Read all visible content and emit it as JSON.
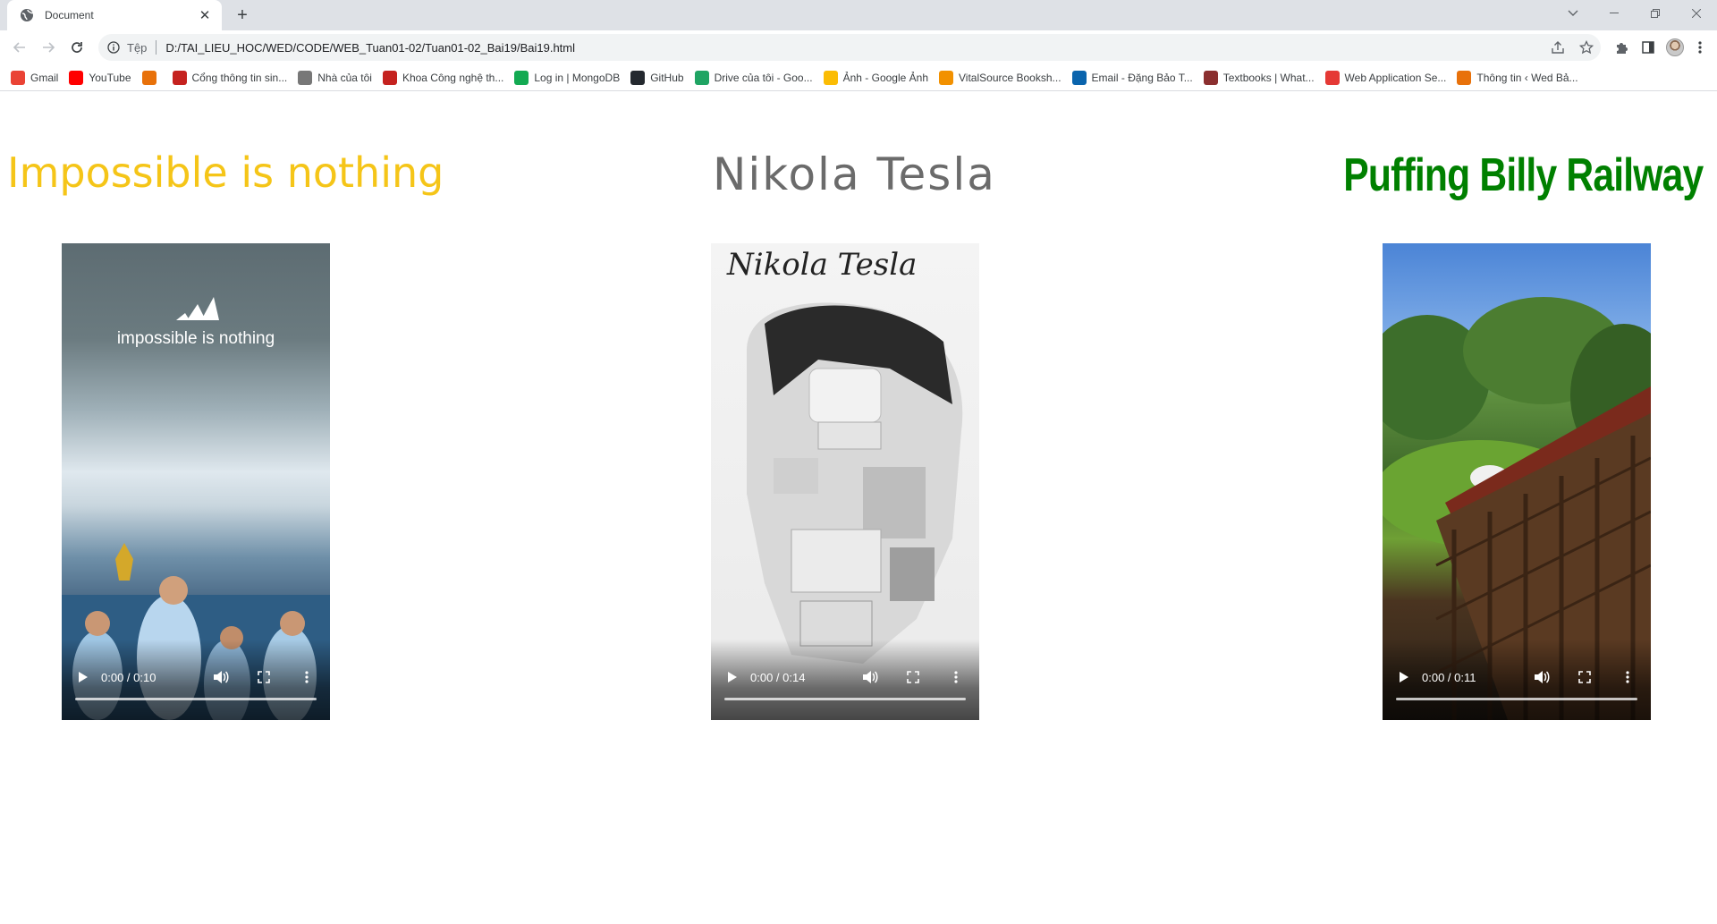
{
  "browser": {
    "tab_title": "Document",
    "address_scheme": "Tệp",
    "address_url": "D:/TAI_LIEU_HOC/WED/CODE/WEB_Tuan01-02/Tuan01-02_Bai19/Bai19.html"
  },
  "bookmarks": [
    {
      "label": "Gmail",
      "icon": "gmail-icon",
      "color": "#ea4335"
    },
    {
      "label": "YouTube",
      "icon": "youtube-icon",
      "color": "#ff0000"
    },
    {
      "label": "",
      "icon": "grid-app-icon",
      "color": "#e8710a"
    },
    {
      "label": "Cổng thông tin sin...",
      "icon": "university-icon",
      "color": "#c5221f"
    },
    {
      "label": "Nhà của tôi",
      "icon": "home-doc-icon",
      "color": "#777777"
    },
    {
      "label": "Khoa Công nghệ th...",
      "icon": "university-icon",
      "color": "#c5221f"
    },
    {
      "label": "Log in | MongoDB",
      "icon": "mongodb-icon",
      "color": "#13aa52"
    },
    {
      "label": "GitHub",
      "icon": "github-icon",
      "color": "#24292f"
    },
    {
      "label": "Drive của tôi - Goo...",
      "icon": "drive-icon",
      "color": "#1fa463"
    },
    {
      "label": "Ảnh - Google Ảnh",
      "icon": "photos-icon",
      "color": "#fbbc04"
    },
    {
      "label": "VitalSource Booksh...",
      "icon": "vitalsource-icon",
      "color": "#f29100"
    },
    {
      "label": "Email - Đặng Bảo T...",
      "icon": "outlook-icon",
      "color": "#0a64ad"
    },
    {
      "label": "Textbooks | What...",
      "icon": "shield-icon",
      "color": "#8b2f2f"
    },
    {
      "label": "Web Application Se...",
      "icon": "webapp-icon",
      "color": "#e53935"
    },
    {
      "label": "Thông tin ‹ Wed Bả...",
      "icon": "grid-app-icon",
      "color": "#e8710a"
    }
  ],
  "page": {
    "headings": {
      "left": "Impossible is nothing",
      "center": "Nikola Tesla",
      "right": "Puffing Billy Railway"
    },
    "videos": [
      {
        "time": "0:00 / 0:10",
        "progress": 0,
        "overlay_text": "impossible is nothing"
      },
      {
        "time": "0:00 / 0:14",
        "progress": 0,
        "overlay_text": "Nikola Tesla"
      },
      {
        "time": "0:00 / 0:11",
        "progress": 0,
        "overlay_text": ""
      }
    ]
  },
  "colors": {
    "left_heading": "#f5c518",
    "center_heading": "#6b6b6b",
    "right_heading": "#008000"
  }
}
